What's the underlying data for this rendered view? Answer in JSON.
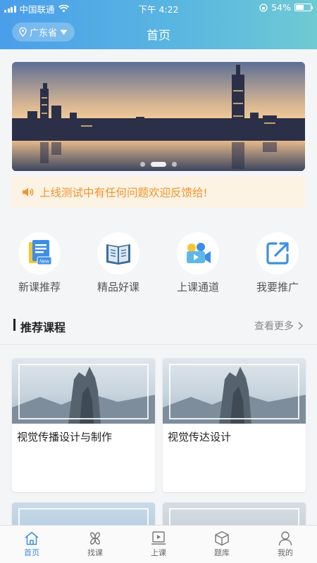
{
  "status_bar": {
    "carrier": "中国联通",
    "time": "下午 4:22",
    "battery": "54%",
    "battery_level": 0.54
  },
  "header": {
    "location": "广东省",
    "title": "首页"
  },
  "banner": {
    "slide_count": 3,
    "active_slide": 2
  },
  "notice": {
    "text": "上线测试中有任何问题欢迎反馈给!"
  },
  "quick_nav": [
    {
      "label": "新课推荐",
      "icon": "new-course-icon"
    },
    {
      "label": "精品好课",
      "icon": "book-icon"
    },
    {
      "label": "上课通道",
      "icon": "video-camera-icon"
    },
    {
      "label": "我要推广",
      "icon": "share-edit-icon"
    }
  ],
  "section": {
    "title": "推荐课程",
    "more": "查看更多"
  },
  "courses": [
    {
      "title": "视觉传播设计与制作"
    },
    {
      "title": "视觉传达设计"
    },
    {
      "title": ""
    },
    {
      "title": ""
    }
  ],
  "tabbar": [
    {
      "label": "首页",
      "icon": "home-icon",
      "active": true
    },
    {
      "label": "找课",
      "icon": "find-course-icon",
      "active": false
    },
    {
      "label": "上课",
      "icon": "class-icon",
      "active": false
    },
    {
      "label": "题库",
      "icon": "question-bank-icon",
      "active": false
    },
    {
      "label": "我的",
      "icon": "profile-icon",
      "active": false
    }
  ],
  "colors": {
    "accent": "#3b8ddb",
    "notice": "#f2922b",
    "header_start": "#4a9eea",
    "header_end": "#6fcad3"
  }
}
